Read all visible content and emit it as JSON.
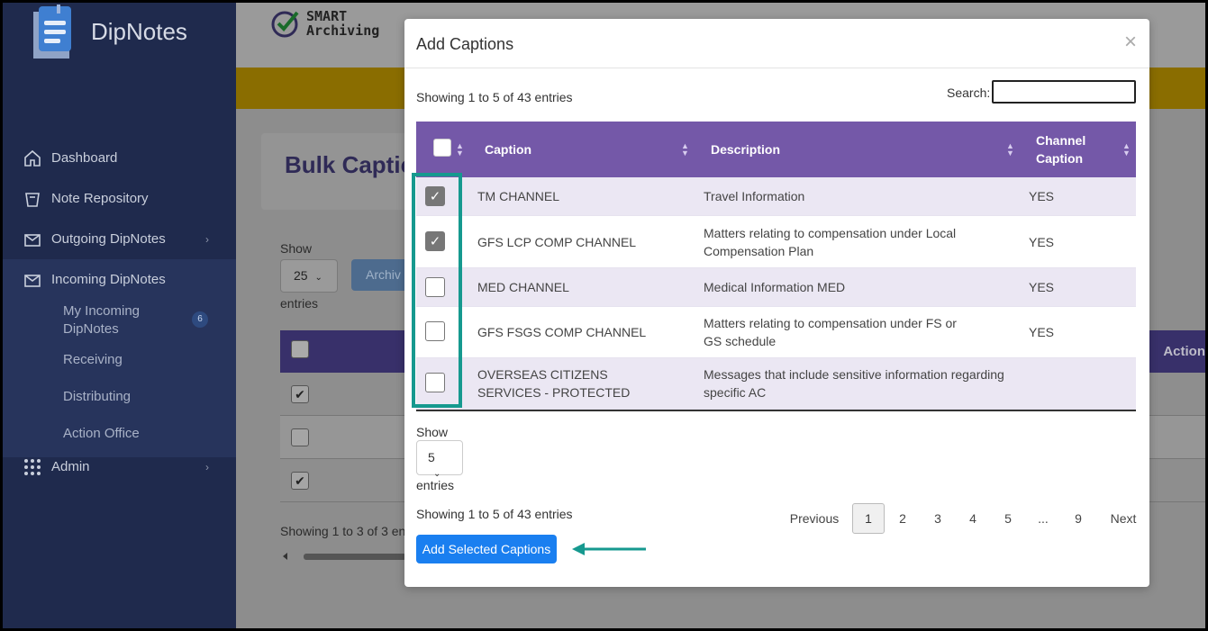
{
  "sidebar": {
    "brand": "DipNotes",
    "items": [
      {
        "label": "Dashboard"
      },
      {
        "label": "Note Repository"
      },
      {
        "label": "Outgoing DipNotes"
      },
      {
        "label": "Incoming DipNotes"
      }
    ],
    "incoming_sub": [
      {
        "label": "My Incoming DipNotes",
        "badge": "6"
      },
      {
        "label": "Receiving"
      },
      {
        "label": "Distributing"
      },
      {
        "label": "Action Office"
      }
    ],
    "admin": "Admin"
  },
  "background": {
    "smart_line1": "SMART",
    "smart_line2": "Archiving",
    "page_title": "Bulk Captic",
    "show_label": "Show",
    "page_size": "25",
    "entries_label": "entries",
    "archive_button": "Archiv",
    "action_header": "Action",
    "showing": "Showing 1 to 3 of 3 ent"
  },
  "modal": {
    "title": "Add Captions",
    "close": "×",
    "info_top": "Showing 1 to 5 of 43 entries",
    "search_label": "Search:",
    "search_value": "",
    "columns": [
      "Caption",
      "Description",
      "Channel Caption"
    ],
    "rows": [
      {
        "checked": true,
        "caption": "TM CHANNEL",
        "description": "Travel Information",
        "channel": "YES"
      },
      {
        "checked": true,
        "caption": "GFS LCP COMP CHANNEL",
        "description": "Matters relating to compensation under Local Compensation Plan",
        "channel": "YES"
      },
      {
        "checked": false,
        "caption": "MED CHANNEL",
        "description": "Medical Information MED",
        "channel": "YES"
      },
      {
        "checked": false,
        "caption": "GFS FSGS COMP CHANNEL",
        "description": "Matters relating to compensation under FS or GS schedule",
        "channel": "YES"
      },
      {
        "checked": false,
        "caption": "OVERSEAS CITIZENS SERVICES - PROTECTED",
        "description": "Messages that include sensitive information regarding specific AC",
        "channel": ""
      }
    ],
    "show_label": "Show",
    "page_size": "5",
    "entries_label": "entries",
    "info_bottom": "Showing 1 to 5 of 43 entries",
    "add_button": "Add Selected Captions",
    "pager": {
      "previous": "Previous",
      "pages": [
        "1",
        "2",
        "3",
        "4",
        "5",
        "...",
        "9"
      ],
      "next": "Next",
      "current": "1"
    }
  },
  "colors": {
    "sidebar": "#1f2a4d",
    "table_header": "#7458a8",
    "highlight": "#16998f",
    "primary_button": "#1a7ff0"
  }
}
